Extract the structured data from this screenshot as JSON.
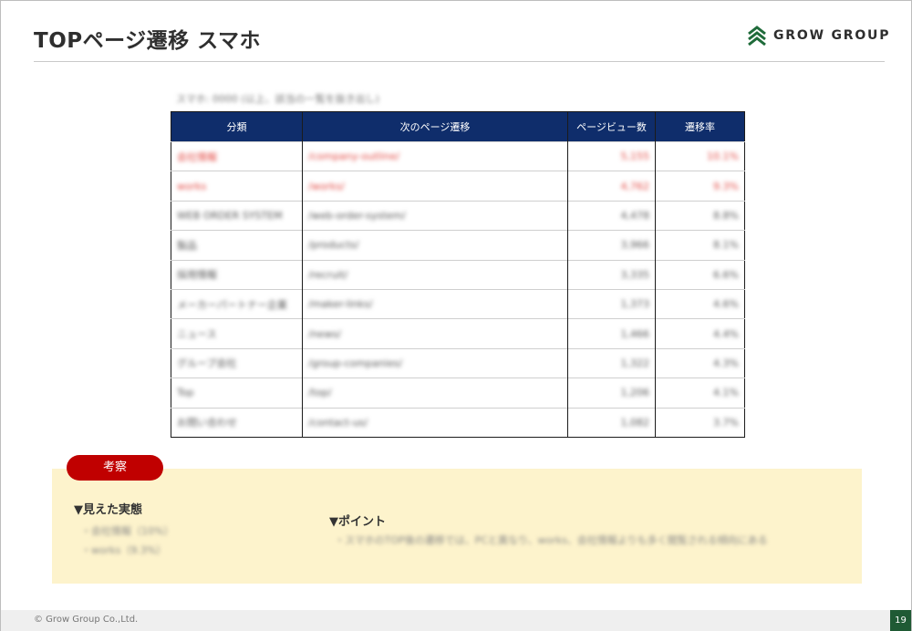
{
  "header": {
    "title": "TOPページ遷移 スマホ",
    "logo_text": "GROW GROUP"
  },
  "caption": "スマホ: 0000 (以上、該当の一覧を抜き出し)",
  "table": {
    "headers": [
      "分類",
      "次のページ遷移",
      "ページビュー数",
      "遷移率"
    ],
    "rows": [
      {
        "category": "会社情報",
        "next_page": "/company-outline/",
        "pageviews": "5,155",
        "rate": "10.1%",
        "highlight": true
      },
      {
        "category": "works",
        "next_page": "/works/",
        "pageviews": "4,762",
        "rate": "9.3%",
        "highlight": true
      },
      {
        "category": "WEB ORDER SYSTEM",
        "next_page": "/web-order-system/",
        "pageviews": "4,478",
        "rate": "8.8%",
        "highlight": false
      },
      {
        "category": "製品",
        "next_page": "/products/",
        "pageviews": "3,966",
        "rate": "8.1%",
        "highlight": false
      },
      {
        "category": "採用情報",
        "next_page": "/recruit/",
        "pageviews": "3,335",
        "rate": "6.6%",
        "highlight": false
      },
      {
        "category": "メーカーパートナー企業",
        "next_page": "/maker-links/",
        "pageviews": "1,373",
        "rate": "4.6%",
        "highlight": false
      },
      {
        "category": "ニュース",
        "next_page": "/news/",
        "pageviews": "1,466",
        "rate": "4.4%",
        "highlight": false
      },
      {
        "category": "グループ会社",
        "next_page": "/group-companies/",
        "pageviews": "1,322",
        "rate": "4.3%",
        "highlight": false
      },
      {
        "category": "Top",
        "next_page": "/top/",
        "pageviews": "1,206",
        "rate": "4.1%",
        "highlight": false
      },
      {
        "category": "お問い合わせ",
        "next_page": "/contact-us/",
        "pageviews": "1,082",
        "rate": "3.7%",
        "highlight": false
      }
    ]
  },
  "insight": {
    "label": "考察",
    "seen_heading": "▼見えた実態",
    "seen_items": [
      "・会社情報（10%）",
      "・works（9.3%）"
    ],
    "point_heading": "▼ポイント",
    "point_items": [
      "・スマホのTOP後の遷移では、PCと異なり、works、会社情報よりも多く閲覧される傾向にある"
    ]
  },
  "footer": {
    "copyright": "© Grow Group Co.,Ltd.",
    "page_number": "19"
  },
  "colors": {
    "table_header": "#0f2d6b",
    "highlight_text": "#e2453f",
    "pill": "#c00000",
    "insight_box": "#fdf3cc",
    "page_badge": "#1f5a34"
  }
}
